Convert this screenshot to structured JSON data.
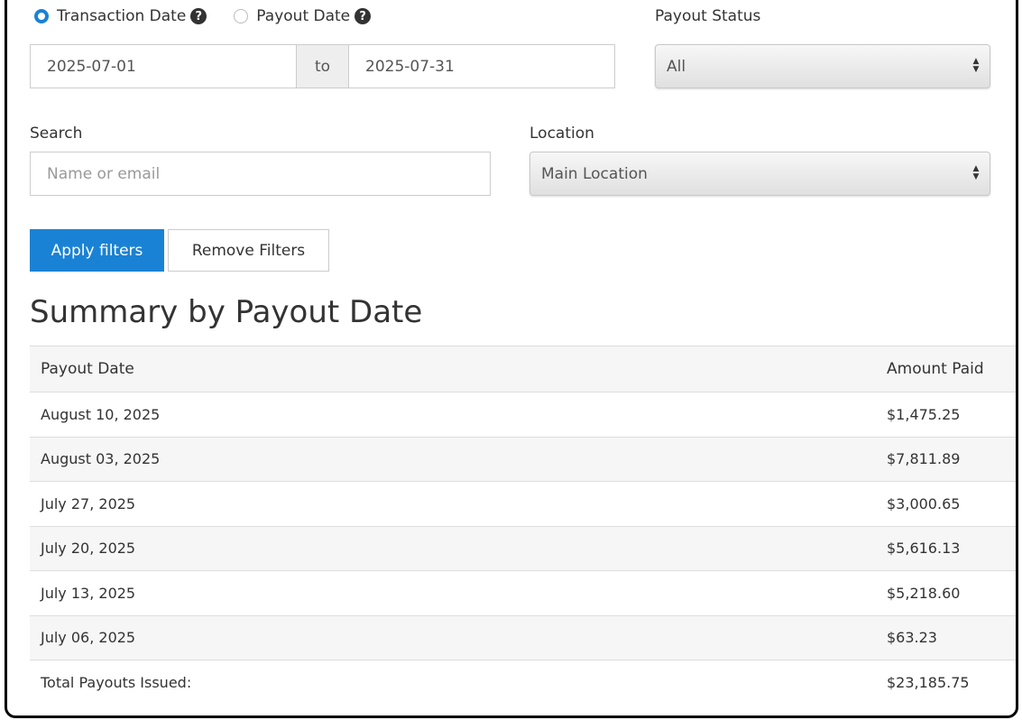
{
  "date_type": {
    "options": [
      {
        "label": "Transaction Date",
        "checked": true
      },
      {
        "label": "Payout Date",
        "checked": false
      }
    ]
  },
  "date_range": {
    "start": "2025-07-01",
    "separator": "to",
    "end": "2025-07-31"
  },
  "payout_status": {
    "label": "Payout Status",
    "selected": "All"
  },
  "search": {
    "label": "Search",
    "placeholder": "Name or email"
  },
  "location": {
    "label": "Location",
    "selected": "Main Location"
  },
  "buttons": {
    "apply": "Apply filters",
    "remove": "Remove Filters"
  },
  "summary": {
    "title": "Summary by Payout Date",
    "columns": [
      "Payout Date",
      "Amount Paid"
    ],
    "rows": [
      {
        "date": "August 10, 2025",
        "amount": "$1,475.25"
      },
      {
        "date": "August 03, 2025",
        "amount": "$7,811.89"
      },
      {
        "date": "July 27, 2025",
        "amount": "$3,000.65"
      },
      {
        "date": "July 20, 2025",
        "amount": "$5,616.13"
      },
      {
        "date": "July 13, 2025",
        "amount": "$5,218.60"
      },
      {
        "date": "July 06, 2025",
        "amount": "$63.23"
      }
    ],
    "total_label": "Total Payouts Issued:",
    "total_amount": "$23,185.75"
  },
  "colors": {
    "primary": "#1a82d4",
    "stripe": "#f6f6f6"
  }
}
